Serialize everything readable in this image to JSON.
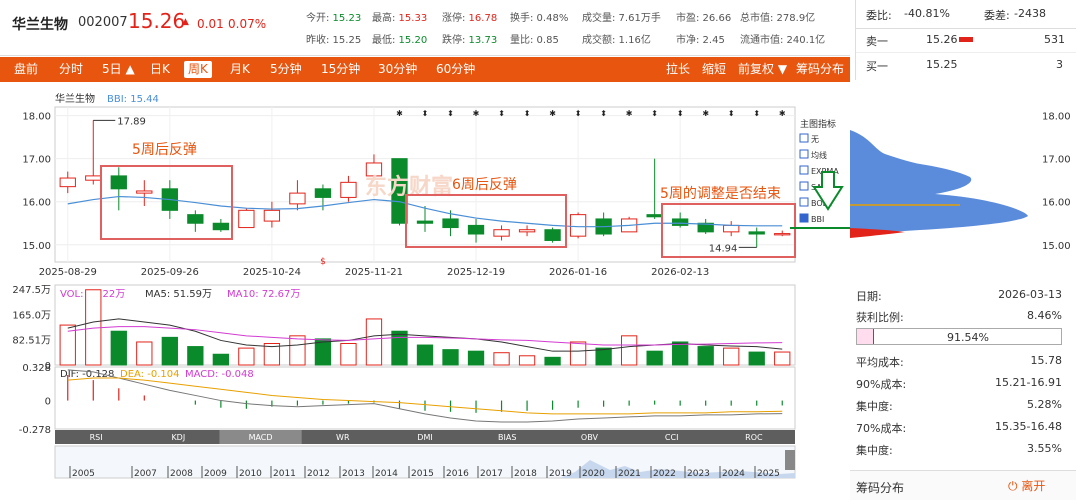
{
  "stock": {
    "name": "华兰生物",
    "code": "002007",
    "price": "15.26",
    "change": "0.01",
    "change_pct": "0.07%",
    "up_arrow": "▲"
  },
  "quote_fields": [
    {
      "label": "今开:",
      "value": "15.23",
      "color": "green"
    },
    {
      "label": "最高:",
      "value": "15.33",
      "color": "red"
    },
    {
      "label": "涨停:",
      "value": "16.78",
      "color": "red"
    },
    {
      "label": "换手:",
      "value": "0.48%",
      "color": "plain"
    },
    {
      "label": "成交量:",
      "value": "7.61万手",
      "color": "plain"
    },
    {
      "label": "市盈:",
      "value": "26.66",
      "color": "plain"
    },
    {
      "label": "总市值:",
      "value": "278.9亿",
      "color": "plain"
    },
    {
      "label": "昨收:",
      "value": "15.25",
      "color": "plain"
    },
    {
      "label": "最低:",
      "value": "15.20",
      "color": "green"
    },
    {
      "label": "跌停:",
      "value": "13.73",
      "color": "green"
    },
    {
      "label": "量比:",
      "value": "0.85",
      "color": "plain"
    },
    {
      "label": "成交额:",
      "value": "1.16亿",
      "color": "plain"
    },
    {
      "label": "市净:",
      "value": "2.45",
      "color": "plain"
    },
    {
      "label": "流通市值:",
      "value": "240.1亿",
      "color": "plain"
    }
  ],
  "order_book": {
    "webi_label": "委比:",
    "webi_value": "-40.81%",
    "wecha_label": "委差:",
    "wecha_value": "-2438",
    "sell1_label": "卖一",
    "sell1_price": "15.26",
    "sell1_vol": "531",
    "buy1_label": "买一",
    "buy1_price": "15.25",
    "buy1_vol": "3"
  },
  "tabs_left": [
    "盘前",
    "分时",
    "5日 ▲",
    "日K",
    "周K",
    "月K",
    "5分钟",
    "15分钟",
    "30分钟",
    "60分钟"
  ],
  "tabs_right": [
    "拉长",
    "缩短",
    "前复权 ▼",
    "筹码分布"
  ],
  "active_tab": "周K",
  "chart_header": {
    "name": "华兰生物",
    "bbi_label": "BBI: 15.44"
  },
  "indicator_menu": {
    "title": "主图指标",
    "items": [
      "无",
      "均线",
      "EXPMA",
      "SAR",
      "BOLL",
      "BBI"
    ],
    "checked": "BBI"
  },
  "annotations": {
    "a1": "5周后反弹",
    "a2": "6周后反弹",
    "a3": "5周的调整是否结束",
    "watermark": "东方财富"
  },
  "price_markers": {
    "high": "17.89",
    "low": "14.94"
  },
  "volume_header": {
    "vol": "VOL: 42.22万",
    "ma5": "MA5: 51.59万",
    "ma10": "MA10: 72.67万"
  },
  "macd_header": {
    "dif": "DIF: -0.128",
    "dea": "DEA: -0.104",
    "macd": "MACD: -0.048"
  },
  "indicator_tabs": [
    "RSI",
    "KDJ",
    "MACD",
    "WR",
    "DMI",
    "BIAS",
    "OBV",
    "CCI",
    "ROC"
  ],
  "active_indicator": "MACD",
  "timeline_years": [
    "2005",
    "2007",
    "2008",
    "2009",
    "2010",
    "2011",
    "2012",
    "2013",
    "2014",
    "2015",
    "2016",
    "2017",
    "2018",
    "2019",
    "2020",
    "2021",
    "2022",
    "2023",
    "2024",
    "2025"
  ],
  "chip_panel": {
    "date_label": "日期:",
    "date_value": "2026-03-13",
    "profit_label": "获利比例:",
    "profit_value": "8.46%",
    "bar_value": "91.54%",
    "avgcost_label": "平均成本:",
    "avgcost_value": "15.78",
    "c90_label": "90%成本:",
    "c90_value": "15.21-16.91",
    "conc90_label": "集中度:",
    "conc90_value": "5.28%",
    "c70_label": "70%成本:",
    "c70_value": "15.35-16.48",
    "conc70_label": "集中度:",
    "conc70_value": "3.55%",
    "footer_label": "筹码分布",
    "exit_label": "离开"
  },
  "colors": {
    "up": "#e2231a",
    "down": "#0a8a2b",
    "accent": "#e8550f",
    "bbi": "#4a8fd6",
    "ma5": "#333333",
    "ma10": "#d23bd2",
    "dea": "#e8a000",
    "annotation": "#e8550f",
    "box": "#e06060"
  },
  "chart_data": {
    "type": "candlestick",
    "x_ticks": [
      "2025-08-29",
      "2025-09-26",
      "2025-10-24",
      "2025-11-21",
      "2025-12-19",
      "2026-01-16",
      "2026-02-13"
    ],
    "y_ticks": [
      "18.00",
      "17.00",
      "16.00",
      "15.00"
    ],
    "ylim": [
      14.6,
      18.2
    ],
    "candles": [
      {
        "o": 16.35,
        "c": 16.55,
        "h": 16.7,
        "l": 16.2
      },
      {
        "o": 16.5,
        "c": 16.6,
        "h": 17.89,
        "l": 16.4
      },
      {
        "o": 16.6,
        "c": 16.3,
        "h": 16.8,
        "l": 15.8
      },
      {
        "o": 16.2,
        "c": 16.25,
        "h": 16.5,
        "l": 15.9
      },
      {
        "o": 16.3,
        "c": 15.8,
        "h": 16.5,
        "l": 15.6
      },
      {
        "o": 15.7,
        "c": 15.5,
        "h": 15.8,
        "l": 15.3
      },
      {
        "o": 15.5,
        "c": 15.35,
        "h": 15.6,
        "l": 15.3
      },
      {
        "o": 15.4,
        "c": 15.8,
        "h": 15.85,
        "l": 15.4
      },
      {
        "o": 15.55,
        "c": 15.8,
        "h": 16.0,
        "l": 15.4
      },
      {
        "o": 15.95,
        "c": 16.2,
        "h": 16.5,
        "l": 15.8
      },
      {
        "o": 16.3,
        "c": 16.1,
        "h": 16.4,
        "l": 15.8
      },
      {
        "o": 16.1,
        "c": 16.45,
        "h": 16.6,
        "l": 16.0
      },
      {
        "o": 16.6,
        "c": 16.9,
        "h": 17.1,
        "l": 16.5
      },
      {
        "o": 17.0,
        "c": 15.5,
        "h": 17.0,
        "l": 15.45
      },
      {
        "o": 15.55,
        "c": 15.5,
        "h": 15.9,
        "l": 15.3
      },
      {
        "o": 15.6,
        "c": 15.4,
        "h": 15.8,
        "l": 15.2
      },
      {
        "o": 15.45,
        "c": 15.25,
        "h": 15.6,
        "l": 15.05
      },
      {
        "o": 15.2,
        "c": 15.35,
        "h": 15.45,
        "l": 15.1
      },
      {
        "o": 15.3,
        "c": 15.35,
        "h": 15.45,
        "l": 15.2
      },
      {
        "o": 15.35,
        "c": 15.1,
        "h": 15.4,
        "l": 15.05
      },
      {
        "o": 15.2,
        "c": 15.7,
        "h": 15.75,
        "l": 15.15
      },
      {
        "o": 15.6,
        "c": 15.25,
        "h": 15.75,
        "l": 15.2
      },
      {
        "o": 15.3,
        "c": 15.6,
        "h": 15.65,
        "l": 15.3
      },
      {
        "o": 15.7,
        "c": 15.65,
        "h": 17.0,
        "l": 15.6
      },
      {
        "o": 15.6,
        "c": 15.45,
        "h": 15.75,
        "l": 15.4
      },
      {
        "o": 15.5,
        "c": 15.3,
        "h": 15.6,
        "l": 15.25
      },
      {
        "o": 15.3,
        "c": 15.45,
        "h": 15.55,
        "l": 15.2
      },
      {
        "o": 15.3,
        "c": 15.25,
        "h": 15.4,
        "l": 14.94
      },
      {
        "o": 15.23,
        "c": 15.26,
        "h": 15.33,
        "l": 15.2
      }
    ],
    "bbi": [
      15.95,
      16.05,
      16.12,
      16.1,
      16.05,
      15.98,
      15.9,
      15.85,
      15.83,
      15.84,
      15.9,
      15.98,
      16.05,
      16.0,
      15.85,
      15.72,
      15.62,
      15.55,
      15.5,
      15.45,
      15.42,
      15.42,
      15.45,
      15.5,
      15.5,
      15.48,
      15.45,
      15.44,
      15.44
    ],
    "volume_yticks": [
      "247.5万",
      "165.0万",
      "82.51万",
      "0"
    ],
    "volume": [
      130,
      245,
      110,
      75,
      90,
      60,
      35,
      55,
      70,
      95,
      85,
      70,
      150,
      110,
      65,
      50,
      45,
      40,
      30,
      25,
      75,
      55,
      95,
      45,
      75,
      60,
      55,
      42,
      42.22
    ],
    "vol_ma5": [
      120,
      140,
      150,
      140,
      130,
      110,
      80,
      65,
      60,
      65,
      75,
      80,
      95,
      100,
      95,
      90,
      85,
      75,
      60,
      45,
      45,
      50,
      60,
      65,
      70,
      65,
      62,
      60,
      51.59
    ],
    "vol_ma10": [
      110,
      120,
      125,
      125,
      120,
      115,
      105,
      95,
      90,
      85,
      82,
      80,
      85,
      90,
      90,
      88,
      85,
      82,
      80,
      75,
      70,
      65,
      65,
      65,
      67,
      68,
      70,
      72,
      72.67
    ],
    "macd_yticks": [
      "0.328",
      "0",
      "-0.278"
    ],
    "macd_hist": [
      0.25,
      0.2,
      0.12,
      0.05,
      0.0,
      -0.04,
      -0.07,
      -0.08,
      -0.06,
      -0.05,
      -0.04,
      -0.03,
      -0.02,
      -0.08,
      -0.1,
      -0.11,
      -0.12,
      -0.11,
      -0.1,
      -0.09,
      -0.07,
      -0.06,
      -0.05,
      -0.04,
      -0.05,
      -0.05,
      -0.05,
      -0.05,
      -0.048
    ],
    "dif": [
      0.3,
      0.28,
      0.22,
      0.16,
      0.1,
      0.05,
      0.0,
      -0.03,
      -0.05,
      -0.06,
      -0.05,
      -0.04,
      -0.03,
      -0.08,
      -0.13,
      -0.17,
      -0.2,
      -0.21,
      -0.21,
      -0.2,
      -0.18,
      -0.17,
      -0.16,
      -0.15,
      -0.15,
      -0.14,
      -0.14,
      -0.13,
      -0.128
    ],
    "dea": [
      0.2,
      0.22,
      0.22,
      0.2,
      0.17,
      0.14,
      0.11,
      0.08,
      0.05,
      0.03,
      0.01,
      0.0,
      -0.01,
      -0.02,
      -0.04,
      -0.06,
      -0.08,
      -0.1,
      -0.12,
      -0.13,
      -0.13,
      -0.13,
      -0.13,
      -0.12,
      -0.12,
      -0.12,
      -0.11,
      -0.11,
      -0.104
    ]
  }
}
